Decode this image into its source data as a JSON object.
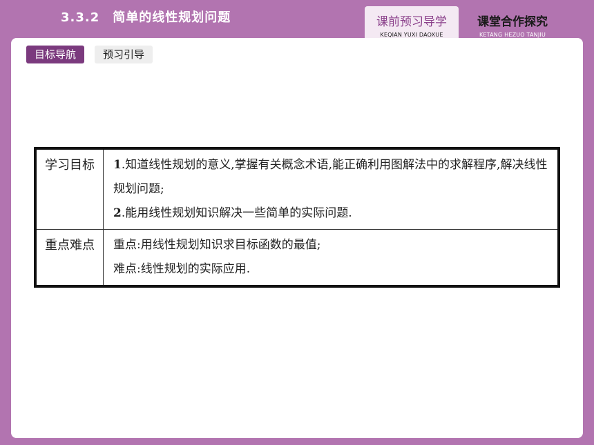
{
  "header": {
    "title": "3.3.2　简单的线性规划问题",
    "tabs": [
      {
        "label": "课前预习导学",
        "pinyin": "KEQIAN YUXI DAOXUE",
        "active": true
      },
      {
        "label": "课堂合作探究",
        "pinyin": "KETANG HEZUO TANJIU",
        "active": false
      }
    ]
  },
  "panel": {
    "subtabs": [
      {
        "label": "目标导航",
        "active": true
      },
      {
        "label": "预习引导",
        "active": false
      }
    ],
    "table": {
      "rows": [
        {
          "head": "学习目标",
          "lines": [
            {
              "num": "1",
              "text": ".知道线性规划的意义,掌握有关概念术语,能正确利用图解法中的求解程序,解决线性规划问题;"
            },
            {
              "num": "2",
              "text": ".能用线性规划知识解决一些简单的实际问题."
            }
          ]
        },
        {
          "head": "重点难点",
          "lines": [
            {
              "text": "重点:用线性规划知识求目标函数的最值;"
            },
            {
              "text": "难点:线性规划的实际应用."
            }
          ]
        }
      ]
    }
  },
  "colors": {
    "background": "#b274b0",
    "active_tab": "#7b3a7e",
    "header_active_bg": "#f4e9f3"
  }
}
